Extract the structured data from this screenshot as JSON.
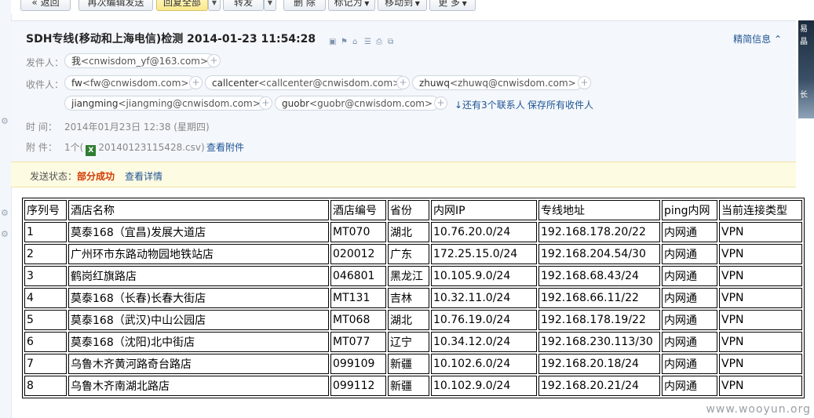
{
  "toolbar": {
    "back": "« 返回",
    "resend": "再次编辑发送",
    "reply_all": "回复全部",
    "forward": "转发",
    "delete": "删 除",
    "mark_as": "标记为",
    "move_to": "移动到",
    "more": "更 多"
  },
  "mail": {
    "subject": "SDH专线(移动和上海电信)检测 2014-01-23 11:54:28",
    "brief_toggle": "精简信息",
    "from_label": "发件人：",
    "from": {
      "name": "我",
      "addr": "<cnwisdom_yf@163.com>"
    },
    "to_label": "收件人：",
    "recipients": [
      {
        "name": "fw",
        "addr": "<fw@cnwisdom.com>"
      },
      {
        "name": "callcenter",
        "addr": "<callcenter@cnwisdom.com>"
      },
      {
        "name": "zhuwq",
        "addr": "<zhuwq@cnwisdom.com>"
      },
      {
        "name": "jiangming",
        "addr": "<jiangming@cnwisdom.com>"
      },
      {
        "name": "guobr",
        "addr": "<guobr@cnwisdom.com>"
      }
    ],
    "more_contacts": "↓还有3个联系人",
    "save_all": "保存所有收件人",
    "time_label": "时   间：",
    "time": "2014年01月23日 12:38 (星期四)",
    "attach_label": "附   件：",
    "attach_count": "1个(",
    "attach_file": "20140123115428.csv",
    "attach_close": ")",
    "view_attach": "查看附件"
  },
  "status": {
    "label": "发送状态：",
    "value": "部分成功",
    "details": "查看详情"
  },
  "table": {
    "headers": [
      "序列号",
      "酒店名称",
      "酒店编号",
      "省份",
      "内网IP",
      "专线地址",
      "ping内网",
      "当前连接类型"
    ],
    "rows": [
      [
        "1",
        "莫泰168（宜昌)发展大道店",
        "MT070",
        "湖北",
        "10.76.20.0/24",
        "192.168.178.20/22",
        "内网通",
        "VPN"
      ],
      [
        "2",
        "广州环市东路动物园地铁站店",
        "020012",
        "广东",
        "172.25.15.0/24",
        "192.168.204.54/30",
        "内网通",
        "VPN"
      ],
      [
        "3",
        "鹤岗红旗路店",
        "046801",
        "黑龙江",
        "10.105.9.0/24",
        "192.168.68.43/24",
        "内网通",
        "VPN"
      ],
      [
        "4",
        "莫泰168（长春)长春大街店",
        "MT131",
        "吉林",
        "10.32.11.0/24",
        "192.168.66.11/22",
        "内网通",
        "VPN"
      ],
      [
        "5",
        "莫泰168（武汉)中山公园店",
        "MT068",
        "湖北",
        "10.76.19.0/24",
        "192.168.178.19/22",
        "内网通",
        "VPN"
      ],
      [
        "6",
        "莫泰168（沈阳)北中街店",
        "MT077",
        "辽宁",
        "10.34.12.0/24",
        "192.168.230.113/30",
        "内网通",
        "VPN"
      ],
      [
        "7",
        "乌鲁木齐黄河路奇台路店",
        "099109",
        "新疆",
        "10.102.6.0/24",
        "192.168.20.18/24",
        "内网通",
        "VPN"
      ],
      [
        "8",
        "乌鲁木齐南湖北路店",
        "099112",
        "新疆",
        "10.102.9.0/24",
        "192.168.20.21/24",
        "内网通",
        "VPN"
      ]
    ]
  },
  "watermark": "www.wooyun.org"
}
